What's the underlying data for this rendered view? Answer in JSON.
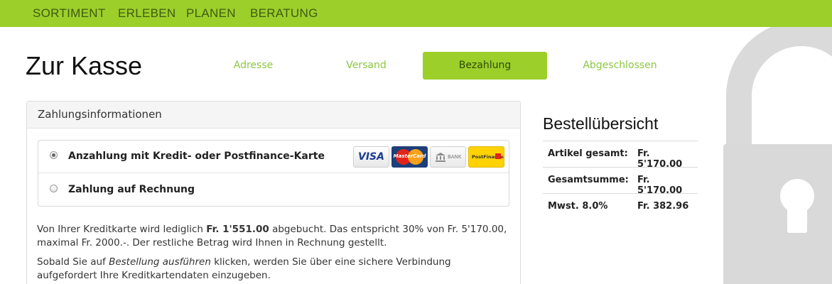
{
  "nav": {
    "items": [
      "SORTIMENT",
      "ERLEBEN",
      "PLANEN",
      "BERATUNG"
    ]
  },
  "page": {
    "title": "Zur Kasse"
  },
  "steps": [
    {
      "label": "Adresse",
      "active": false
    },
    {
      "label": "Versand",
      "active": false
    },
    {
      "label": "Bezahlung",
      "active": true
    },
    {
      "label": "Abgeschlossen",
      "active": false
    }
  ],
  "payment": {
    "heading": "Zahlungsinformationen",
    "options": [
      {
        "label": "Anzahlung mit Kredit- oder Postfinance-Karte",
        "selected": true
      },
      {
        "label": "Zahlung auf Rechnung",
        "selected": false
      }
    ],
    "logos": {
      "visa": "VISA",
      "mastercard": "MasterCard",
      "bank": "BANK",
      "postfinance": "PostFinance"
    },
    "info1": {
      "part1": "Von Ihrer Kreditkarte wird lediglich ",
      "amount": "Fr. 1'551.00",
      "part2": " abgebucht. Das entspricht 30% von Fr. 5'170.00, maximal Fr. 2000.-. Der restliche Betrag wird Ihnen in Rechnung gestellt."
    },
    "info2": {
      "part1": "Sobald Sie auf ",
      "emphasis": "Bestellung ausführen",
      "part2": " klicken, werden Sie über eine sichere Verbindung aufgefordert Ihre Kreditkartendaten einzugeben."
    }
  },
  "summary": {
    "title": "Bestellübersicht",
    "rows": [
      {
        "label": "Artikel gesamt:",
        "value": "Fr. 5'170.00"
      },
      {
        "label": "Gesamtsumme:",
        "value": "Fr. 5'170.00"
      },
      {
        "label": "Mwst. 8.0%",
        "value": "Fr. 382.96"
      }
    ]
  },
  "colors": {
    "accent": "#9ccf2a",
    "step_text": "#8cc63f",
    "lock_gray": "#d9d9d9"
  }
}
